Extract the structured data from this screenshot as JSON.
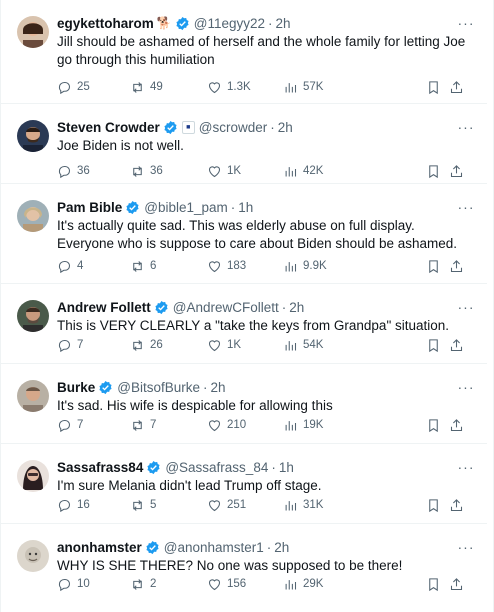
{
  "tweets": [
    {
      "name": "egykettoharom",
      "extra": "🐕",
      "handle": "@11egyy22",
      "time": "2h",
      "text": "Jill should be ashamed of herself and the whole family for letting Joe go through this humiliation",
      "replies": "25",
      "reposts": "49",
      "likes": "1.3K",
      "views": "57K",
      "avatar_color": "#6a4b3c"
    },
    {
      "name": "Steven Crowder",
      "handle": "@scrowder",
      "time": "2h",
      "text": "Joe Biden is not well.",
      "replies": "36",
      "reposts": "36",
      "likes": "1K",
      "views": "42K",
      "avatar_color": "#2b3a55"
    },
    {
      "name": "Pam Bible",
      "handle": "@bible1_pam",
      "time": "1h",
      "text": "It's actually quite sad.  This was elderly abuse on full display.  Everyone who is suppose to care about Biden should be ashamed.",
      "replies": "4",
      "reposts": "6",
      "likes": "183",
      "views": "9.9K",
      "avatar_color": "#b59a78"
    },
    {
      "name": "Andrew Follett",
      "handle": "@AndrewCFollett",
      "time": "2h",
      "text": "This is VERY CLEARLY a \"take the keys from Grandpa\" situation.",
      "replies": "7",
      "reposts": "26",
      "likes": "1K",
      "views": "54K",
      "avatar_color": "#5b4a3f"
    },
    {
      "name": "Burke",
      "handle": "@BitsofBurke",
      "time": "2h",
      "text": "It's sad. His wife is despicable for allowing this",
      "replies": "7",
      "reposts": "7",
      "likes": "210",
      "views": "19K",
      "avatar_color": "#8a7b6e"
    },
    {
      "name": "Sassafrass84",
      "handle": "@Sassafrass_84",
      "time": "1h",
      "text": "I'm sure Melania didn't lead Trump off stage.",
      "replies": "16",
      "reposts": "5",
      "likes": "251",
      "views": "31K",
      "avatar_color": "#3d2c2e"
    },
    {
      "name": "anonhamster",
      "handle": "@anonhamster1",
      "time": "2h",
      "text": "WHY IS SHE THERE? No one was supposed to be there!",
      "replies": "10",
      "reposts": "2",
      "likes": "156",
      "views": "29K",
      "avatar_color": "#c9c2b6"
    }
  ],
  "colors": {
    "verified": "#1d9bf0",
    "muted_text": "#536471",
    "divider": "#eff3f4"
  }
}
